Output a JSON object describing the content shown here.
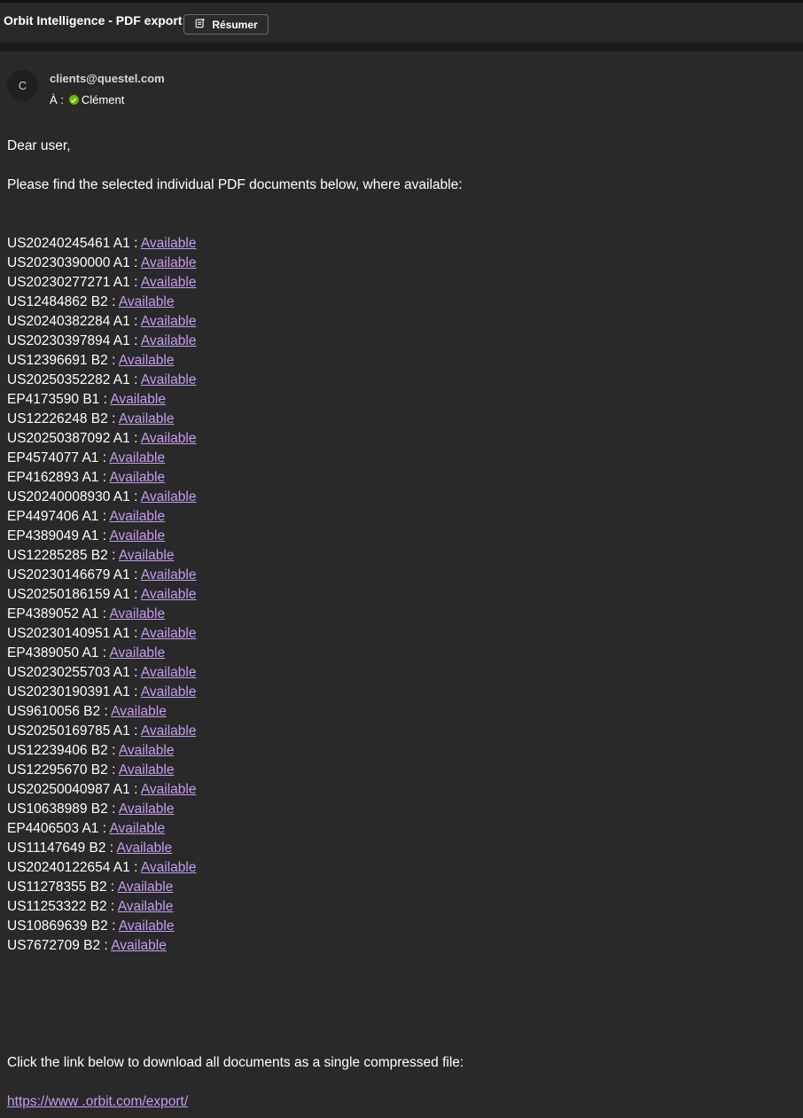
{
  "header": {
    "subject": "Orbit Intelligence - PDF export",
    "summarize_label": "Résumer"
  },
  "sender": {
    "avatar_initial": "C",
    "email": "clients@questel.com",
    "to_label": "À :",
    "recipient": "Clément"
  },
  "body": {
    "greeting": "Dear user,",
    "intro": "Please find the selected individual PDF documents below, where available:",
    "documents": [
      {
        "id": "US20240245461 A1 :",
        "link": "Available"
      },
      {
        "id": "US20230390000 A1 :",
        "link": "Available"
      },
      {
        "id": "US20230277271 A1 :",
        "link": "Available"
      },
      {
        "id": "US12484862 B2 :",
        "link": "Available"
      },
      {
        "id": "US20240382284 A1 :",
        "link": "Available"
      },
      {
        "id": "US20230397894 A1 :",
        "link": "Available"
      },
      {
        "id": "US12396691 B2 :",
        "link": "Available"
      },
      {
        "id": "US20250352282 A1 :",
        "link": "Available"
      },
      {
        "id": "EP4173590 B1 :",
        "link": "Available"
      },
      {
        "id": "US12226248 B2 :",
        "link": "Available"
      },
      {
        "id": "US20250387092 A1 :",
        "link": "Available"
      },
      {
        "id": "EP4574077 A1 :",
        "link": "Available"
      },
      {
        "id": "EP4162893 A1 :",
        "link": "Available"
      },
      {
        "id": "US20240008930 A1 :",
        "link": "Available"
      },
      {
        "id": "EP4497406 A1 :",
        "link": "Available"
      },
      {
        "id": "EP4389049 A1 :",
        "link": "Available"
      },
      {
        "id": "US12285285 B2 :",
        "link": "Available"
      },
      {
        "id": "US20230146679 A1 :",
        "link": "Available"
      },
      {
        "id": "US20250186159 A1 :",
        "link": "Available"
      },
      {
        "id": "EP4389052 A1 :",
        "link": "Available"
      },
      {
        "id": "US20230140951 A1 :",
        "link": "Available"
      },
      {
        "id": "EP4389050 A1 :",
        "link": "Available"
      },
      {
        "id": "US20230255703 A1 :",
        "link": "Available"
      },
      {
        "id": "US20230190391 A1 :",
        "link": "Available"
      },
      {
        "id": "US9610056 B2 :",
        "link": "Available"
      },
      {
        "id": "US20250169785 A1 :",
        "link": "Available"
      },
      {
        "id": "US12239406 B2 :",
        "link": "Available"
      },
      {
        "id": "US12295670 B2 :",
        "link": "Available"
      },
      {
        "id": "US20250040987 A1 :",
        "link": "Available"
      },
      {
        "id": "US10638989 B2 :",
        "link": "Available"
      },
      {
        "id": "EP4406503 A1 :",
        "link": "Available"
      },
      {
        "id": "US11147649 B2 :",
        "link": "Available"
      },
      {
        "id": "US20240122654 A1 :",
        "link": "Available"
      },
      {
        "id": "US11278355 B2 :",
        "link": "Available"
      },
      {
        "id": "US11253322 B2 :",
        "link": "Available"
      },
      {
        "id": "US10869639 B2 :",
        "link": "Available"
      },
      {
        "id": "US7672709 B2 :",
        "link": "Available"
      }
    ],
    "download_text": "Click the link below to download all documents as a single compressed file:",
    "download_link": "https://www      .orbit.com/export/"
  },
  "colors": {
    "background": "#292929",
    "link": "#c79cf2",
    "presence_available": "#6bb700"
  },
  "icons": {
    "summarize": "summarize-icon",
    "presence": "available-check-icon"
  }
}
